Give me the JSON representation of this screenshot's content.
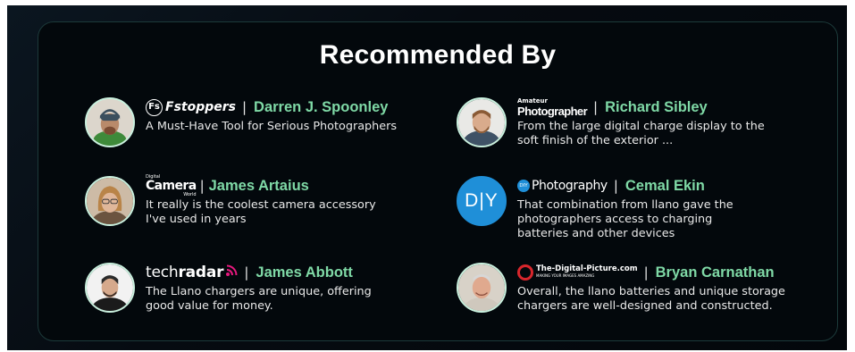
{
  "section": {
    "title": "Recommended By"
  },
  "items": [
    {
      "outlet": "Fstoppers",
      "name": "Darren J. Spoonley",
      "desc_lines": [
        "A Must-Have Tool for Serious Photographers"
      ]
    },
    {
      "outlet_small": "Amateur",
      "outlet": "Photographer",
      "name": "Richard Sibley",
      "desc_lines": [
        "From the large digital charge display to the",
        "soft finish of the exterior ..."
      ]
    },
    {
      "outlet_small": "Digital",
      "outlet": "Camera",
      "outlet_sub": "World",
      "name": "James Artaius",
      "desc_lines": [
        "It really is the coolest camera accessory",
        "I've used in years"
      ]
    },
    {
      "avatar_text": "D|Y",
      "outlet_badge": "DIY",
      "outlet": "Photography",
      "name": "Cemal Ekin",
      "desc_lines": [
        "That combination from llano gave the",
        "photographers access to charging",
        "batteries and other devices"
      ]
    },
    {
      "outlet_a": "tech",
      "outlet_b": "radar",
      "name": "James Abbott",
      "desc_lines": [
        "The Llano chargers are unique, offering",
        "good value for money."
      ]
    },
    {
      "outlet": "The-Digital-Picture.com",
      "outlet_sub": "MAKING YOUR IMAGES AMAZING",
      "name": "Bryan Carnathan",
      "desc_lines": [
        "Overall, the llano batteries and unique storage",
        "chargers are well-designed and constructed."
      ]
    }
  ],
  "separator": "|",
  "colors": {
    "accent": "#7fd9a6",
    "panel_border": "#1c3a3a",
    "background": "#03080c",
    "diy_blue": "#1f8fd8",
    "techradar_pink": "#e6197e"
  }
}
